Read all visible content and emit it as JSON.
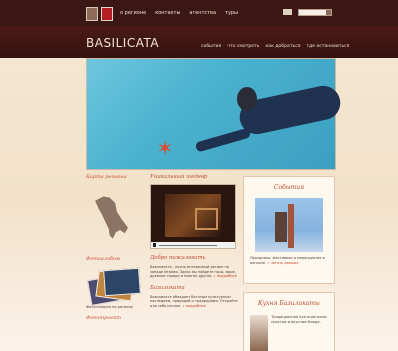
{
  "topbar": {
    "nav": [
      "о регионе",
      "контакты",
      "агентства",
      "туры"
    ]
  },
  "brand": "BASILICATA",
  "subnav": [
    "события",
    "что смотреть",
    "как добраться",
    "где остановиться"
  ],
  "hero": {
    "image": "diver-underwater-with-starfish"
  },
  "left_column": {
    "map_title": "Карта региона",
    "photoalbum_title": "Фотоальбом",
    "photoalbum_caption": "Фотогалерея по региону",
    "photoproject_title": "Фотопроект"
  },
  "center": {
    "video_title": "Уникальный шедевр",
    "welcome_title": "Добро пожаловать",
    "welcome_text": "Базиликата - очень интересный регион на западе Италии. Здесь вы найдете горы, море, древние города и многое другое.",
    "welcome_link": "» подробнее",
    "basilicata_title": "Базиликата",
    "basilicata_text": "Базиликата обладает богатым культурным наследием, природой и традициями. Откройте для себя регион.",
    "basilicata_link": "» подробнее"
  },
  "right": {
    "events_title": "События",
    "events_text": "Праздники, фестивали и мероприятия в регионе.",
    "events_link": "» читать дальше",
    "cuisine_title": "Кухня Базиликаты",
    "cuisine_text": "Традиционная кухня региона: простые и вкусные блюда."
  }
}
